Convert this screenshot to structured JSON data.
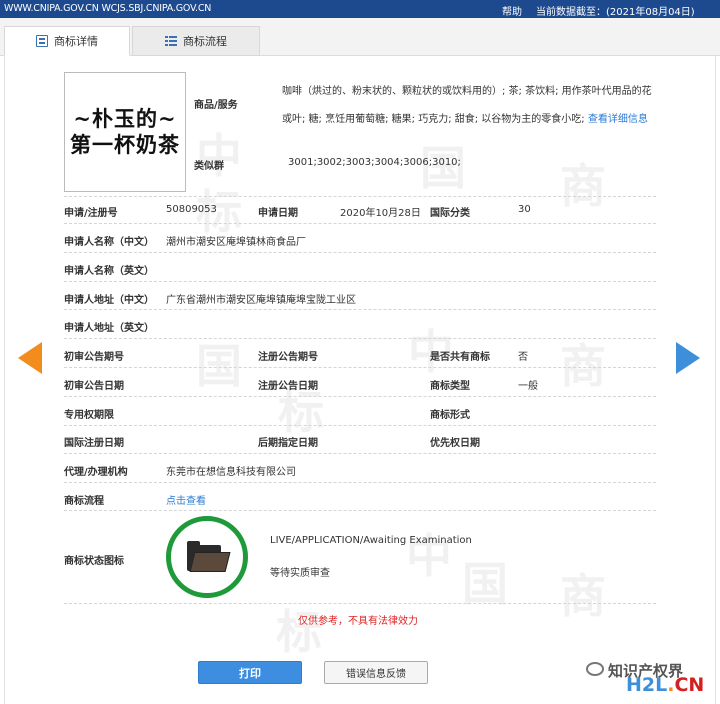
{
  "topbar": {
    "url": "WWW.CNIPA.GOV.CN WCJS.SBJ.CNIPA.GOV.CN",
    "help": "帮助",
    "data_as_of_label": "当前数据截至：",
    "data_as_of_date": "(2021年08月04日)"
  },
  "tabs": [
    {
      "label": "商标详情",
      "icon": "document-icon",
      "active": true
    },
    {
      "label": "商标流程",
      "icon": "list-icon",
      "active": false
    }
  ],
  "trademark": {
    "logo_text_line1": "~朴玉的~",
    "logo_text_line2": "第一杯奶茶",
    "goods_label": "商品/服务",
    "goods_text": "咖啡（烘过的、粉末状的、颗粒状的或饮料用的）; 茶; 茶饮料; 用作茶叶代用品的花或叶; 糖; 烹饪用葡萄糖; 糖果; 巧克力; 甜食; 以谷物为主的零食小吃;",
    "goods_link": "查看详细信息",
    "similar_group_label": "类似群",
    "similar_group_value": "3001;3002;3003;3004;3006;3010;"
  },
  "details": {
    "reg_no_label": "申请/注册号",
    "reg_no": "50809053",
    "app_date_label": "申请日期",
    "app_date": "2020年10月28日",
    "intl_class_label": "国际分类",
    "intl_class": "30",
    "applicant_cn_label": "申请人名称（中文）",
    "applicant_cn": "潮州市潮安区庵埠镇林商食品厂",
    "applicant_en_label": "申请人名称（英文）",
    "applicant_en": "",
    "address_cn_label": "申请人地址（中文）",
    "address_cn": "广东省潮州市潮安区庵埠镇庵埠宝陇工业区",
    "address_en_label": "申请人地址（英文）",
    "address_en": "",
    "prelim_pub_no_label": "初审公告期号",
    "reg_pub_no_label": "注册公告期号",
    "shared_label": "是否共有商标",
    "shared_value": "否",
    "prelim_pub_date_label": "初审公告日期",
    "reg_pub_date_label": "注册公告日期",
    "mark_type_label": "商标类型",
    "mark_type_value": "一般",
    "exclusive_period_label": "专用权期限",
    "mark_form_label": "商标形式",
    "intl_reg_date_label": "国际注册日期",
    "later_designation_label": "后期指定日期",
    "priority_date_label": "优先权日期",
    "agent_label": "代理/办理机构",
    "agent_value": "东莞市在想信息科技有限公司",
    "process_label": "商标流程",
    "process_link": "点击查看",
    "status_icon_label": "商标状态图标",
    "status_en": "LIVE/APPLICATION/Awaiting Examination",
    "status_cn": "等待实质审查"
  },
  "footer": {
    "warning": "仅供参考，不具有法律效力",
    "print_button": "打印",
    "report_button": "错误信息反馈"
  },
  "watermark": {
    "brand": "知识产权界",
    "site_a": "H2L",
    "site_b": ".",
    "site_c": "CN",
    "bg_chars": [
      "中",
      "国",
      "商",
      "标"
    ]
  },
  "colors": {
    "topbar": "#1d4a8f",
    "link": "#2b7bd4",
    "warning": "#e02020",
    "print_button": "#3d8ee0",
    "prev_arrow": "#f28c1c",
    "next_arrow": "#3c8fd8",
    "status_ring": "#1e9a3a"
  }
}
